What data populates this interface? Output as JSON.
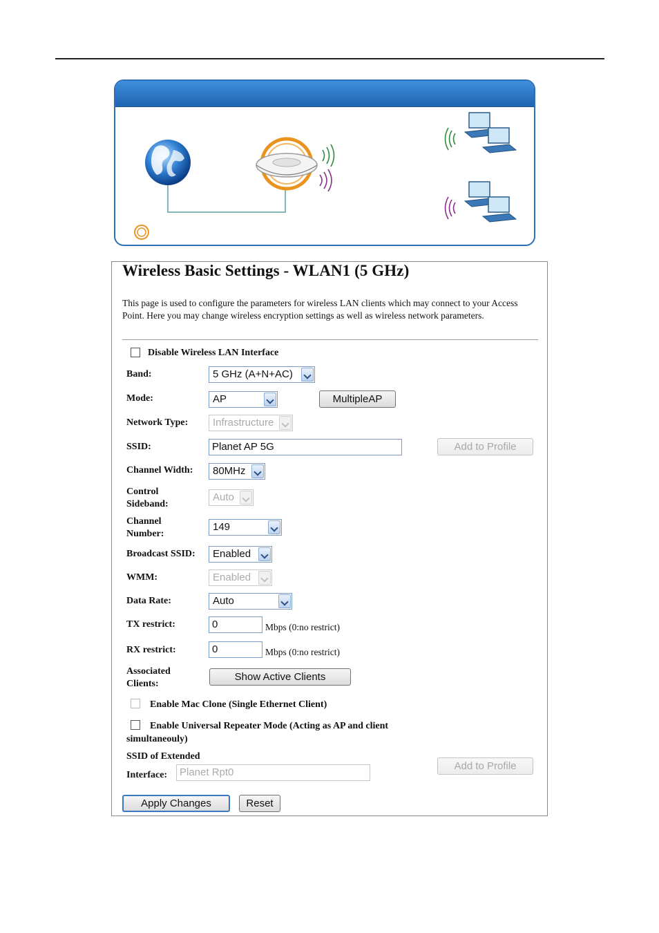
{
  "page": {
    "title": "Wireless Basic Settings - WLAN1 (5 GHz)",
    "description": "This page is used to configure the parameters for wireless LAN clients which may connect to your Access Point. Here you may change wireless encryption settings as well as wireless network parameters."
  },
  "banner": {
    "accent_colors": {
      "header": "#2a6fb8",
      "device_ring": "#e8941f",
      "signal_green": "#2e8b3a",
      "signal_purple": "#8a2e8a"
    },
    "icons": [
      "globe-icon",
      "access-point-icon",
      "laptop-pair-icon",
      "laptop-pair-icon",
      "ring-icon"
    ]
  },
  "form": {
    "disable_wlan_label": "Disable Wireless LAN Interface",
    "band": {
      "label": "Band:",
      "value": "5 GHz (A+N+AC)"
    },
    "mode": {
      "label": "Mode:",
      "value": "AP",
      "multiple_ap_button": "MultipleAP"
    },
    "network_type": {
      "label": "Network Type:",
      "value": "Infrastructure"
    },
    "ssid": {
      "label": "SSID:",
      "value": "Planet AP 5G",
      "add_profile_button": "Add to Profile"
    },
    "channel_width": {
      "label": "Channel Width:",
      "value": "80MHz"
    },
    "control_sideband": {
      "label_line1": "Control",
      "label_line2": "Sideband:",
      "value": "Auto"
    },
    "channel_number": {
      "label_line1": "Channel",
      "label_line2": "Number:",
      "value": "149"
    },
    "broadcast_ssid": {
      "label": "Broadcast SSID:",
      "value": "Enabled"
    },
    "wmm": {
      "label": "WMM:",
      "value": "Enabled"
    },
    "data_rate": {
      "label": "Data Rate:",
      "value": "Auto"
    },
    "tx_restrict": {
      "label": "TX restrict:",
      "value": "0",
      "unit": "Mbps (0:no restrict)"
    },
    "rx_restrict": {
      "label": "RX restrict:",
      "value": "0",
      "unit": "Mbps (0:no restrict)"
    },
    "associated_clients": {
      "label_line1": "Associated",
      "label_line2": "Clients:",
      "button": "Show Active Clients"
    },
    "mac_clone_label": "Enable Mac Clone (Single Ethernet Client)",
    "repeater_label_line1": "Enable Universal Repeater Mode (Acting as AP and client",
    "repeater_label_line2": "simultaneouly)",
    "ssid_extended": {
      "label_line1": "SSID of Extended",
      "label_line2": "Interface:",
      "placeholder": "Planet Rpt0",
      "add_profile_button": "Add to Profile"
    },
    "apply_button": "Apply Changes",
    "reset_button": "Reset"
  }
}
